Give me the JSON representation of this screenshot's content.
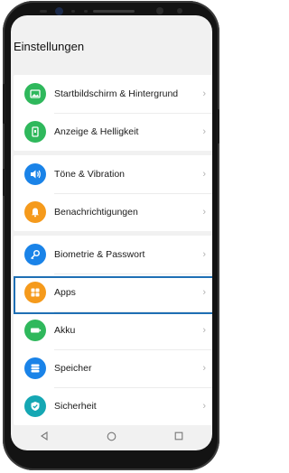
{
  "screen": {
    "title": "Einstellungen"
  },
  "groups": [
    {
      "items": [
        {
          "label": "Startbildschirm & Hintergrund",
          "icon": "image-icon",
          "color": "#2fb85c"
        },
        {
          "label": "Anzeige & Helligkeit",
          "icon": "display-icon",
          "color": "#2fb85c"
        }
      ]
    },
    {
      "items": [
        {
          "label": "Töne & Vibration",
          "icon": "sound-icon",
          "color": "#1a83e8"
        },
        {
          "label": "Benachrichtigungen",
          "icon": "bell-icon",
          "color": "#f59a1c"
        }
      ]
    },
    {
      "items": [
        {
          "label": "Biometrie & Passwort",
          "icon": "key-icon",
          "color": "#1a83e8"
        },
        {
          "label": "Apps",
          "icon": "apps-icon",
          "color": "#f59a1c"
        },
        {
          "label": "Akku",
          "icon": "battery-icon",
          "color": "#2fb85c"
        },
        {
          "label": "Speicher",
          "icon": "storage-icon",
          "color": "#1a83e8"
        },
        {
          "label": "Sicherheit",
          "icon": "shield-icon",
          "color": "#15a7b3"
        }
      ]
    }
  ],
  "highlight": {
    "item": "Apps",
    "color": "#1f6fb4"
  },
  "navbar": {
    "back": "back-icon",
    "home": "home-icon",
    "recents": "recents-icon"
  }
}
